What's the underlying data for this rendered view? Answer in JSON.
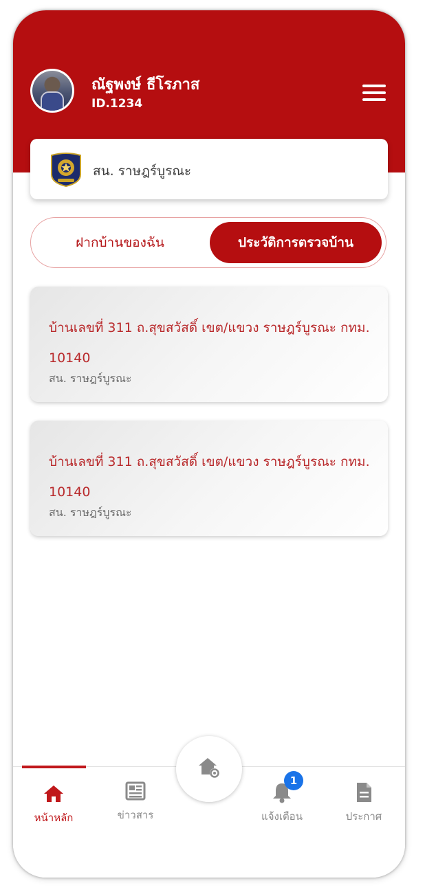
{
  "user": {
    "name": "ณัฐพงษ์ ธีโรภาส",
    "id": "ID.1234"
  },
  "station": {
    "name": "สน. ราษฎร์บูรณะ"
  },
  "tabs": {
    "left_label": "ฝากบ้านของฉัน",
    "right_label": "ประวัติการตรวจบ้าน",
    "active": "right"
  },
  "houses": [
    {
      "address": "บ้านเลขที่ 311 ถ.สุขสวัสดิ์ เขต/แขวง ราษฎร์บูรณะ กทม. 10140",
      "station": "สน. ราษฎร์บูรณะ"
    },
    {
      "address": "บ้านเลขที่ 311 ถ.สุขสวัสดิ์ เขต/แขวง ราษฎร์บูรณะ กทม. 10140",
      "station": "สน. ราษฎร์บูรณะ"
    }
  ],
  "bottom_nav": {
    "home_label": "หน้าหลัก",
    "news_label": "ข่าวสาร",
    "notify_label": "แจ้งเตือน",
    "notify_count": "1",
    "announce_label": "ประกาศ",
    "active": "home"
  },
  "icons": {
    "menu": "hamburger-menu-icon",
    "badge": "police-badge-icon",
    "home": "home-icon",
    "news": "newspaper-icon",
    "fab": "house-add-icon",
    "notify": "bell-icon",
    "announce": "document-icon"
  },
  "colors": {
    "brand_red": "#b50e10",
    "address_red": "#b92a2c",
    "notify_blue": "#1a73e8"
  }
}
